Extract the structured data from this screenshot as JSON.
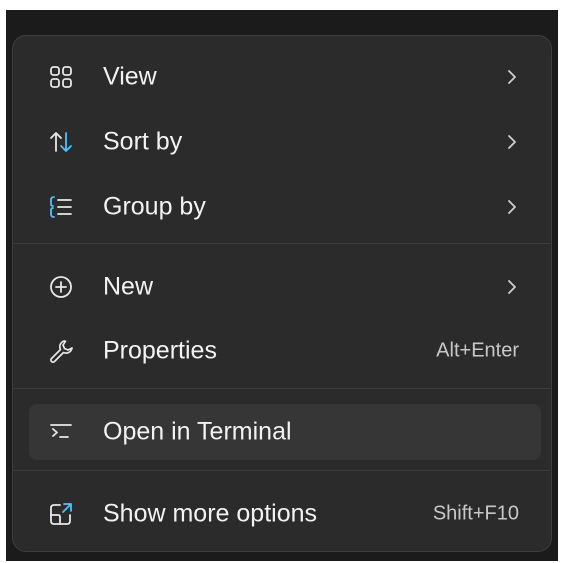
{
  "menu": {
    "items": [
      {
        "label": "View",
        "icon": "view-grid-icon",
        "submenu": true
      },
      {
        "label": "Sort by",
        "icon": "sort-icon",
        "submenu": true
      },
      {
        "label": "Group by",
        "icon": "group-by-icon",
        "submenu": true
      },
      {
        "label": "New",
        "icon": "new-plus-icon",
        "submenu": true
      },
      {
        "label": "Properties",
        "icon": "wrench-icon",
        "shortcut": "Alt+Enter"
      },
      {
        "label": "Open in Terminal",
        "icon": "terminal-icon",
        "highlighted": true
      },
      {
        "label": "Show more options",
        "icon": "show-more-options-icon",
        "shortcut": "Shift+F10"
      }
    ]
  },
  "colors": {
    "menu_background": "#2b2b2b",
    "hover_background": "#363636",
    "text": "#f2f2f2",
    "accent_blue": "#4cc2ff"
  }
}
